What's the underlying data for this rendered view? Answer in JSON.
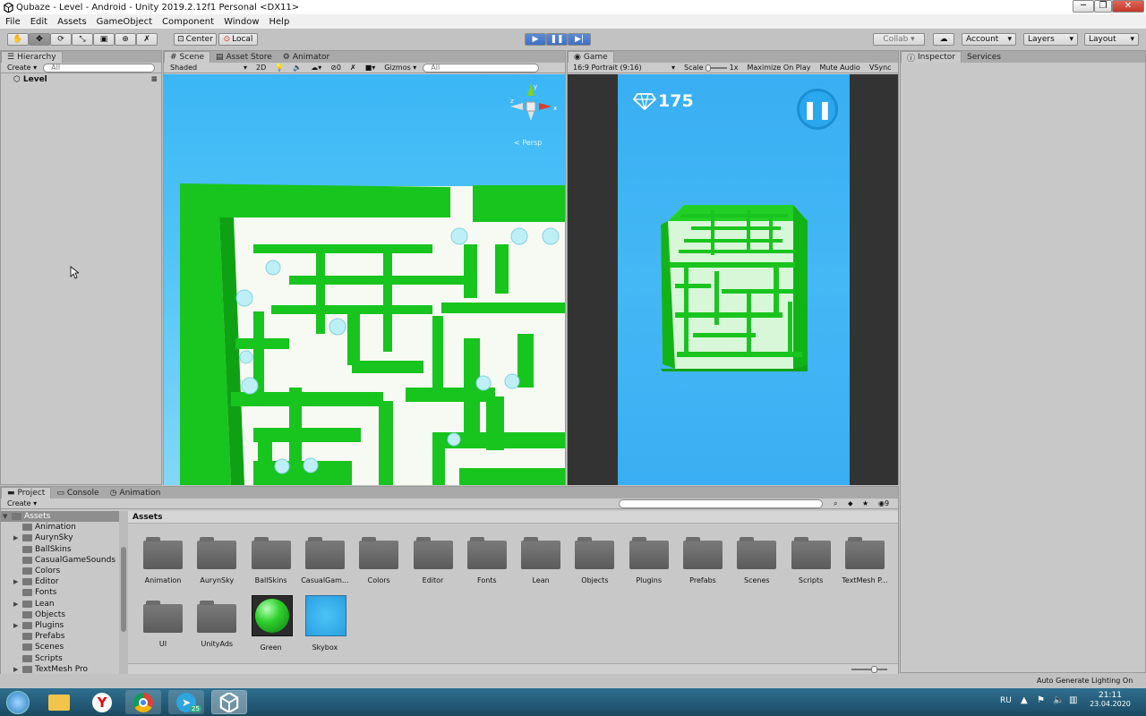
{
  "window": {
    "title": "Qubaze - Level - Android - Unity 2019.2.12f1 Personal <DX11>",
    "min": "─",
    "max": "❐",
    "close": "✕"
  },
  "menu": [
    "File",
    "Edit",
    "Assets",
    "GameObject",
    "Component",
    "Window",
    "Help"
  ],
  "toolbar": {
    "pivot": "Center",
    "space": "Local",
    "collab": "Collab ▾",
    "account": "Account",
    "layers": "Layers",
    "layout": "Layout"
  },
  "hierarchy": {
    "tab": "Hierarchy",
    "create": "Create",
    "search_placeholder": "All",
    "root": "Level"
  },
  "scene": {
    "tabs": [
      "Scene",
      "Asset Store",
      "Animator"
    ],
    "shading": "Shaded",
    "mode2d": "2D",
    "fx_count": "0",
    "gizmos": "Gizmos",
    "search_placeholder": "All",
    "persp": "< Persp",
    "axis_x": "x",
    "axis_z": "z",
    "axis_y": "y"
  },
  "game": {
    "tab": "Game",
    "aspect": "16:9 Portrait (9:16)",
    "scale_label": "Scale",
    "scale_value": "1x",
    "max_on_play": "Maximize On Play",
    "mute": "Mute Audio",
    "vsync": "VSync",
    "gems": "175"
  },
  "inspector": {
    "tabs": [
      "Inspector",
      "Services"
    ]
  },
  "project": {
    "tabs": [
      "Project",
      "Console",
      "Animation"
    ],
    "create": "Create",
    "breadcrumb": "Assets",
    "layer_count": "9",
    "tree": [
      {
        "label": "Assets",
        "arrow": "▼",
        "indent": 0,
        "selected": true
      },
      {
        "label": "Animation",
        "arrow": "",
        "indent": 1
      },
      {
        "label": "AurynSky",
        "arrow": "▶",
        "indent": 1
      },
      {
        "label": "BallSkins",
        "arrow": "",
        "indent": 1
      },
      {
        "label": "CasualGameSounds",
        "arrow": "",
        "indent": 1
      },
      {
        "label": "Colors",
        "arrow": "",
        "indent": 1
      },
      {
        "label": "Editor",
        "arrow": "▶",
        "indent": 1
      },
      {
        "label": "Fonts",
        "arrow": "",
        "indent": 1
      },
      {
        "label": "Lean",
        "arrow": "▶",
        "indent": 1
      },
      {
        "label": "Objects",
        "arrow": "",
        "indent": 1
      },
      {
        "label": "Plugins",
        "arrow": "▶",
        "indent": 1
      },
      {
        "label": "Prefabs",
        "arrow": "",
        "indent": 1
      },
      {
        "label": "Scenes",
        "arrow": "",
        "indent": 1
      },
      {
        "label": "Scripts",
        "arrow": "",
        "indent": 1
      },
      {
        "label": "TextMesh Pro",
        "arrow": "▶",
        "indent": 1
      }
    ],
    "assets": [
      {
        "label": "Animation",
        "kind": "folder"
      },
      {
        "label": "AurynSky",
        "kind": "folder"
      },
      {
        "label": "BallSkins",
        "kind": "folder"
      },
      {
        "label": "CasualGam...",
        "kind": "folder"
      },
      {
        "label": "Colors",
        "kind": "folder"
      },
      {
        "label": "Editor",
        "kind": "folder"
      },
      {
        "label": "Fonts",
        "kind": "folder"
      },
      {
        "label": "Lean",
        "kind": "folder"
      },
      {
        "label": "Objects",
        "kind": "folder"
      },
      {
        "label": "Plugins",
        "kind": "folder"
      },
      {
        "label": "Prefabs",
        "kind": "folder"
      },
      {
        "label": "Scenes",
        "kind": "folder"
      },
      {
        "label": "Scripts",
        "kind": "folder"
      },
      {
        "label": "TextMesh P...",
        "kind": "folder"
      },
      {
        "label": "UI",
        "kind": "folder"
      },
      {
        "label": "UnityAds",
        "kind": "folder"
      },
      {
        "label": "Green",
        "kind": "material"
      },
      {
        "label": "Skybox",
        "kind": "skybox"
      }
    ]
  },
  "status": {
    "lighting": "Auto Generate Lighting On"
  },
  "taskbar": {
    "lang": "RU",
    "time": "21:11",
    "date": "23.04.2020",
    "telegram_badge": "25"
  },
  "colors": {
    "maze_green": "#18c41e",
    "sky": "#35b3f2",
    "play_blue": "#3f6fc2"
  }
}
